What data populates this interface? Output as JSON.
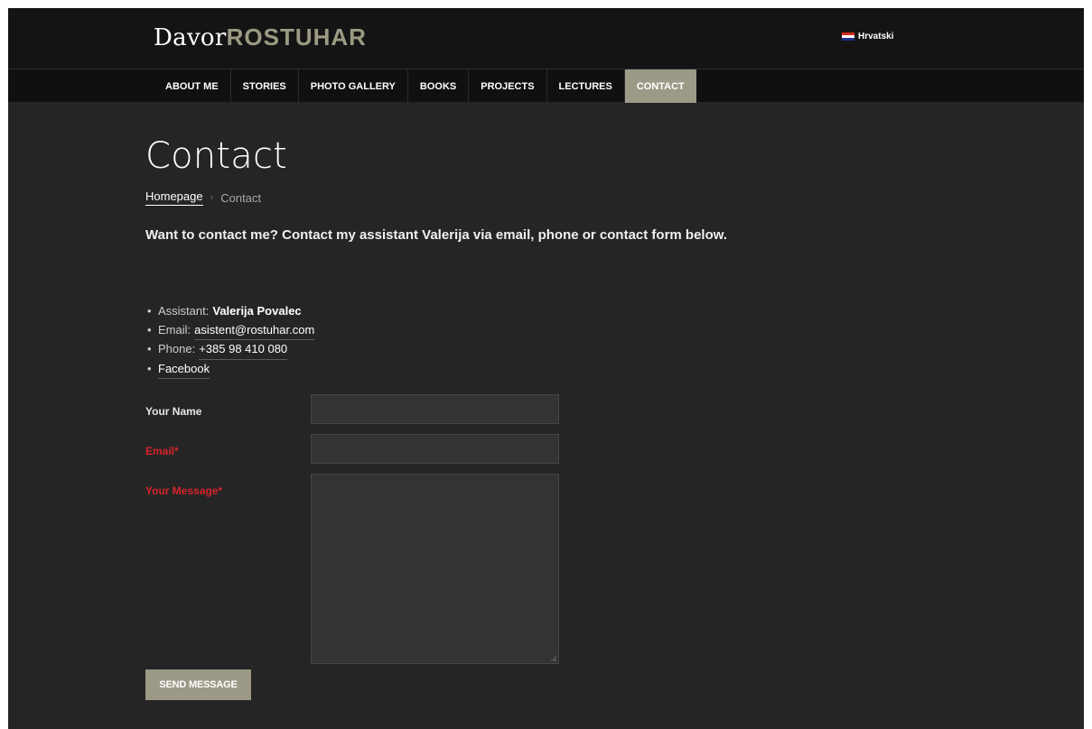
{
  "header": {
    "logo_first": "Davor",
    "logo_last": "ROSTUHAR",
    "language": "Hrvatski"
  },
  "nav": {
    "items": [
      {
        "label": "ABOUT ME"
      },
      {
        "label": "STORIES"
      },
      {
        "label": "PHOTO GALLERY"
      },
      {
        "label": "BOOKS"
      },
      {
        "label": "PROJECTS"
      },
      {
        "label": "LECTURES"
      },
      {
        "label": "CONTACT"
      }
    ],
    "active": "CONTACT"
  },
  "page": {
    "title": "Contact",
    "breadcrumb": {
      "home": "Homepage",
      "separator": "›",
      "current": "Contact"
    },
    "intro": "Want to contact me? Contact my assistant Valerija via email, phone or contact form below."
  },
  "contacts": {
    "assistant_label": "Assistant:",
    "assistant_name": "Valerija Povalec",
    "email_label": "Email:",
    "email_value": "asistent@rostuhar.com",
    "phone_label": "Phone:",
    "phone_value": "+385 98 410 080",
    "facebook_label": "Facebook"
  },
  "form": {
    "name_label": "Your Name",
    "email_label": "Email*",
    "message_label": "Your Message*",
    "submit_label": "SEND MESSAGE"
  },
  "colors": {
    "accent": "#9c9a87",
    "background": "#252525",
    "required": "#d5232a"
  }
}
